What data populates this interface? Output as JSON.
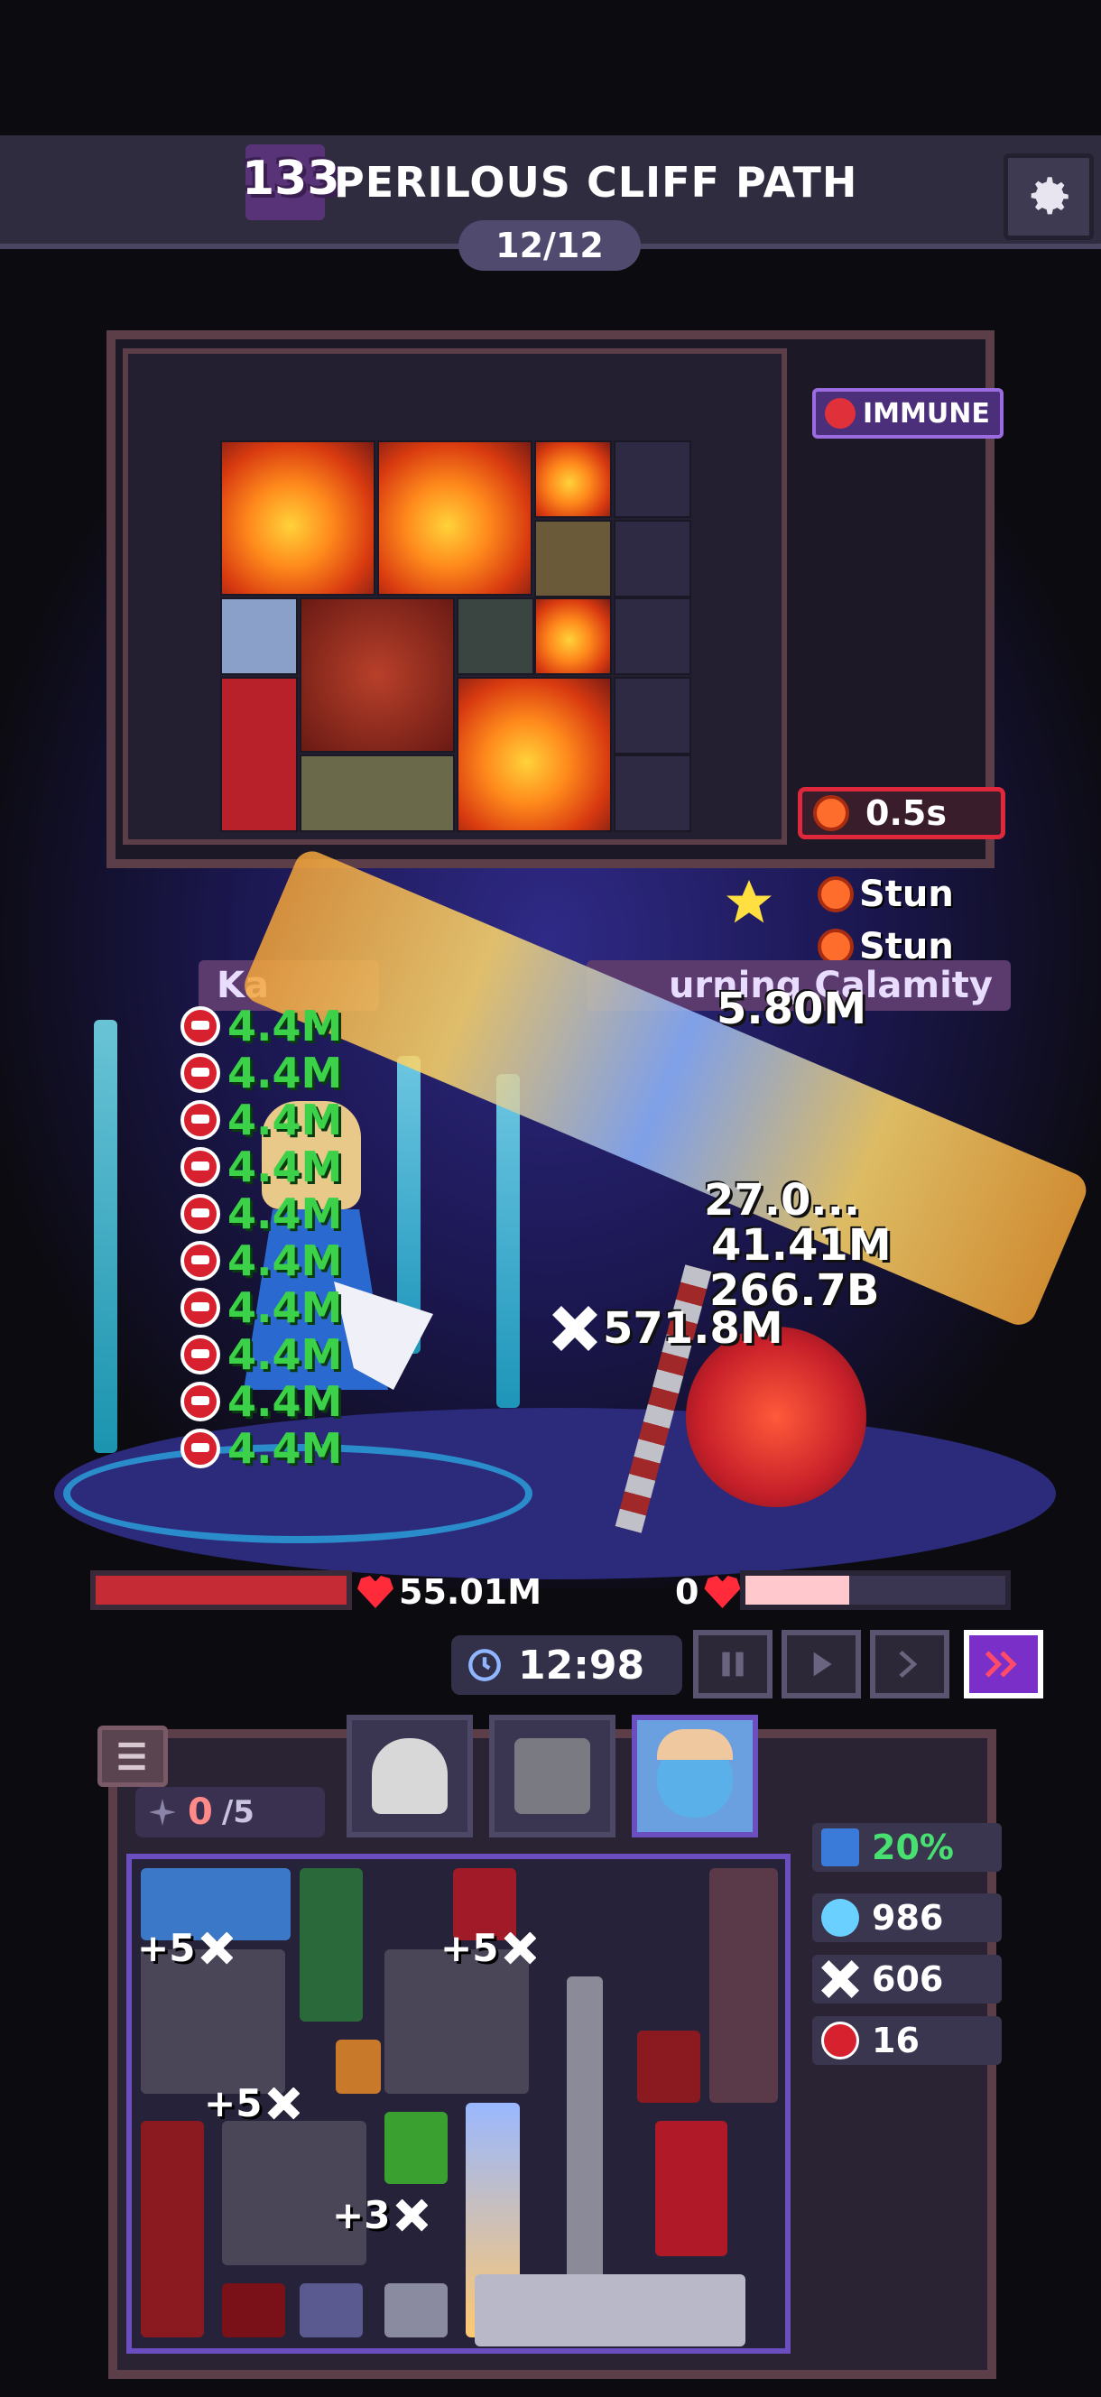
{
  "header": {
    "level": "133",
    "title": "PERILOUS CLIFF PATH",
    "wave": "12/12"
  },
  "enemy_panel": {
    "immune_label": "IMMUNE",
    "timer": "0.5s"
  },
  "status_effects": [
    "Stun",
    "Stun"
  ],
  "player": {
    "name_partial": "Ka",
    "hp": "55.01M",
    "hp_fraction": 1.0
  },
  "enemy": {
    "name_partial": "urning Calamity",
    "hp": "0",
    "hp_fraction": 0.4
  },
  "damage_numbers": [
    "5.80M",
    "27.0...",
    "41.41M",
    "266.7B"
  ],
  "crit_damage": "571.8M",
  "heal_numbers": [
    "4.4M",
    "4.4M",
    "4.4M",
    "4.4M",
    "4.4M",
    "4.4M",
    "4.4M",
    "4.4M",
    "4.4M",
    "4.4M"
  ],
  "controls": {
    "clock": "12:98",
    "buttons": [
      "pause",
      "play",
      "fast-forward",
      "faster"
    ]
  },
  "bag": {
    "slot_current": "0",
    "slot_max": "/5",
    "upgrade_labels": [
      "+5",
      "+5",
      "+5",
      "+3"
    ]
  },
  "stats": [
    {
      "name": "efficiency",
      "value": "20%",
      "color": "#48e070"
    },
    {
      "name": "gems",
      "value": "986",
      "color": "#ffffff"
    },
    {
      "name": "crit",
      "value": "606",
      "color": "#ffffff"
    },
    {
      "name": "lifesteal",
      "value": "16",
      "color": "#ffffff"
    }
  ],
  "colors": {
    "accent_purple": "#7a30c8",
    "heal_green": "#3bd24a",
    "hp_red": "#c42b35"
  }
}
